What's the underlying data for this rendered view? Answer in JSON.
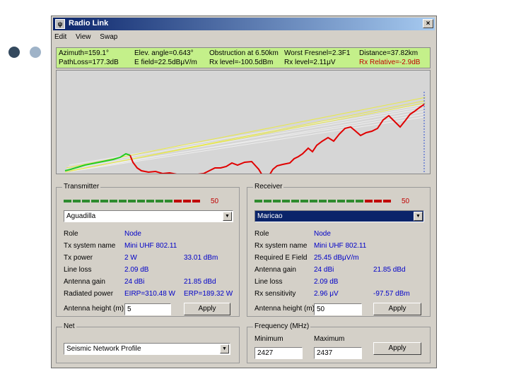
{
  "colors": {
    "accent_dark": "#34495e",
    "accent_light": "#9fb3c8",
    "info_bg": "#c4f08a",
    "meter_green": "#2e8b2e",
    "meter_red": "#c00000",
    "profile_red": "#e00000",
    "profile_green": "#22cc22",
    "fresnel_yellow": "#e8e84a"
  },
  "window": {
    "title": "Radio Link",
    "close_glyph": "×",
    "app_icon": "radio-link-app-icon"
  },
  "menu": [
    "Edit",
    "View",
    "Swap"
  ],
  "info": {
    "row1": [
      "Azimuth=159.1°",
      "Elev. angle=0.643°",
      "Obstruction at 6.50km",
      "Worst Fresnel=2.3F1",
      "Distance=37.82km"
    ],
    "row2": [
      "PathLoss=177.3dB",
      "E field=22.5dBμV/m",
      "Rx level=-100.5dBm",
      "Rx level=2.11μV",
      "Rx Relative=-2.9dB"
    ]
  },
  "transmitter": {
    "title": "Transmitter",
    "meter_value": "50",
    "site": "Aguadilla",
    "rows": [
      {
        "label": "Role",
        "v1": "Node",
        "v2": ""
      },
      {
        "label": "Tx system name",
        "v1": "Mini UHF 802.11",
        "v2": ""
      },
      {
        "label": "Tx power",
        "v1": "2 W",
        "v2": "33.01 dBm"
      },
      {
        "label": "Line loss",
        "v1": "2.09 dB",
        "v2": ""
      },
      {
        "label": "Antenna gain",
        "v1": "24 dBi",
        "v2": "21.85 dBd"
      },
      {
        "label": "Radiated power",
        "v1": "EIRP=310.48 W",
        "v2": "ERP=189.32 W"
      }
    ],
    "antenna_label": "Antenna height (m)",
    "antenna_value": "5",
    "apply": "Apply"
  },
  "receiver": {
    "title": "Receiver",
    "meter_value": "50",
    "site": "Maricao",
    "rows": [
      {
        "label": "Role",
        "v1": "Node",
        "v2": ""
      },
      {
        "label": "Rx system name",
        "v1": "Mini UHF 802.11",
        "v2": ""
      },
      {
        "label": "Required E Field",
        "v1": "25.45 dBμV/m",
        "v2": ""
      },
      {
        "label": "Antenna gain",
        "v1": "24 dBi",
        "v2": "21.85 dBd"
      },
      {
        "label": "Line loss",
        "v1": "2.09 dB",
        "v2": ""
      },
      {
        "label": "Rx sensitivity",
        "v1": "2.96 μV",
        "v2": "-97.57 dBm"
      }
    ],
    "antenna_label": "Antenna height (m)",
    "antenna_value": "50",
    "apply": "Apply"
  },
  "net": {
    "title": "Net",
    "value": "Seismic Network Profile"
  },
  "frequency": {
    "title": "Frequency (MHz)",
    "min_label": "Minimum",
    "max_label": "Maximum",
    "min": "2427",
    "max": "2437",
    "apply": "Apply"
  }
}
